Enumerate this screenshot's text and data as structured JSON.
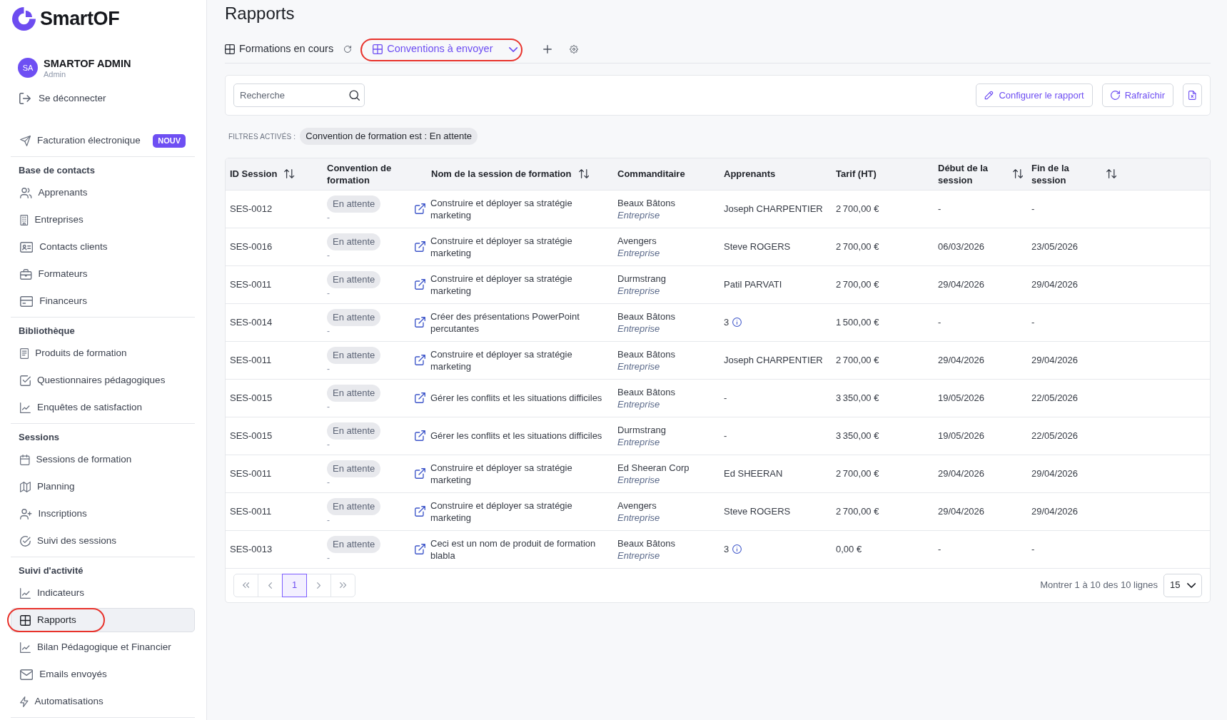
{
  "sidebar": {
    "brand": "SmartOF",
    "user": {
      "initials": "SA",
      "name": "SMARTOF ADMIN",
      "role": "Admin"
    },
    "logout": "Se déconnecter",
    "sections": [
      {
        "items": [
          {
            "label": "Facturation électronique",
            "badge": "NOUV",
            "selected": false,
            "circled": false
          }
        ]
      },
      {
        "heading": "Base de contacts",
        "items": [
          {
            "label": "Apprenants",
            "selected": false,
            "circled": false
          },
          {
            "label": "Entreprises",
            "selected": false,
            "circled": false
          },
          {
            "label": "Contacts clients",
            "selected": false,
            "circled": false
          },
          {
            "label": "Formateurs",
            "selected": false,
            "circled": false
          },
          {
            "label": "Financeurs",
            "selected": false,
            "circled": false
          }
        ]
      },
      {
        "heading": "Bibliothèque",
        "items": [
          {
            "label": "Produits de formation",
            "selected": false,
            "circled": false
          },
          {
            "label": "Questionnaires pédagogiques",
            "selected": false,
            "circled": false
          },
          {
            "label": "Enquêtes de satisfaction",
            "selected": false,
            "circled": false
          }
        ]
      },
      {
        "heading": "Sessions",
        "items": [
          {
            "label": "Sessions de formation",
            "selected": false,
            "circled": false
          },
          {
            "label": "Planning",
            "selected": false,
            "circled": false
          },
          {
            "label": "Inscriptions",
            "selected": false,
            "circled": false
          },
          {
            "label": "Suivi des sessions",
            "selected": false,
            "circled": false
          }
        ]
      },
      {
        "heading": "Suivi d'activité",
        "items": [
          {
            "label": "Indicateurs",
            "selected": false,
            "circled": false
          },
          {
            "label": "Rapports",
            "selected": true,
            "circled": true
          },
          {
            "label": "Bilan Pédagogique et Financier",
            "selected": false,
            "circled": false
          },
          {
            "label": "Emails envoyés",
            "selected": false,
            "circled": false
          },
          {
            "label": "Automatisations",
            "selected": false,
            "circled": false
          }
        ]
      }
    ]
  },
  "page_title": "Rapports",
  "tabs": [
    {
      "label": "Formations en cours",
      "selected": false,
      "circled": false
    },
    {
      "label": "Conventions à envoyer",
      "selected": true,
      "circled": true
    }
  ],
  "toolbar": {
    "search": {
      "placeholder": "Recherche"
    },
    "buttons": [
      "Configurer le rapport",
      "Rafraîchir"
    ]
  },
  "active_filters": {
    "label": "FILTRES ACTIVÉS :",
    "chips": [
      "Convention de formation est : En attente"
    ]
  },
  "table": {
    "columns": [
      {
        "label": "ID Session",
        "sortable": true
      },
      {
        "label": "Convention de formation",
        "sortable": false
      },
      {
        "label": "Nom de la session de formation",
        "sortable": true
      },
      {
        "label": "Commanditaire",
        "sortable": false
      },
      {
        "label": "Apprenants",
        "sortable": false
      },
      {
        "label": "Tarif (HT)",
        "sortable": false
      },
      {
        "label": "Début de la session",
        "sortable": true
      },
      {
        "label": "Fin de la session",
        "sortable": true
      }
    ],
    "rows": [
      {
        "id": "SES-0012",
        "convention": {
          "status": "En attente",
          "note": "-"
        },
        "session": "Construire et déployer sa stratégie marketing",
        "sponsor": {
          "name": "Beaux Bâtons",
          "type": "Entreprise"
        },
        "learners": "Joseph CHARPENTIER",
        "learners_info": false,
        "price": "2 700,00 €",
        "start": "-",
        "end": "-"
      },
      {
        "id": "SES-0016",
        "convention": {
          "status": "En attente",
          "note": "-"
        },
        "session": "Construire et déployer sa stratégie marketing",
        "sponsor": {
          "name": "Avengers",
          "type": "Entreprise"
        },
        "learners": "Steve ROGERS",
        "learners_info": false,
        "price": "2 700,00 €",
        "start": "06/03/2026",
        "end": "23/05/2026"
      },
      {
        "id": "SES-0011",
        "convention": {
          "status": "En attente",
          "note": "-"
        },
        "session": "Construire et déployer sa stratégie marketing",
        "sponsor": {
          "name": "Durmstrang",
          "type": "Entreprise"
        },
        "learners": "Patil PARVATI",
        "learners_info": false,
        "price": "2 700,00 €",
        "start": "29/04/2026",
        "end": "29/04/2026"
      },
      {
        "id": "SES-0014",
        "convention": {
          "status": "En attente",
          "note": "-"
        },
        "session": "Créer des présentations PowerPoint percutantes",
        "sponsor": {
          "name": "Beaux Bâtons",
          "type": "Entreprise"
        },
        "learners": "3",
        "learners_info": true,
        "price": "1 500,00 €",
        "start": "-",
        "end": "-"
      },
      {
        "id": "SES-0011",
        "convention": {
          "status": "En attente",
          "note": "-"
        },
        "session": "Construire et déployer sa stratégie marketing",
        "sponsor": {
          "name": "Beaux Bâtons",
          "type": "Entreprise"
        },
        "learners": "Joseph CHARPENTIER",
        "learners_info": false,
        "price": "2 700,00 €",
        "start": "29/04/2026",
        "end": "29/04/2026"
      },
      {
        "id": "SES-0015",
        "convention": {
          "status": "En attente",
          "note": "-"
        },
        "session": "Gérer les conflits et les situations difficiles",
        "sponsor": {
          "name": "Beaux Bâtons",
          "type": "Entreprise"
        },
        "learners": "-",
        "learners_info": false,
        "price": "3 350,00 €",
        "start": "19/05/2026",
        "end": "22/05/2026"
      },
      {
        "id": "SES-0015",
        "convention": {
          "status": "En attente",
          "note": "-"
        },
        "session": "Gérer les conflits et les situations difficiles",
        "sponsor": {
          "name": "Durmstrang",
          "type": "Entreprise"
        },
        "learners": "-",
        "learners_info": false,
        "price": "3 350,00 €",
        "start": "19/05/2026",
        "end": "22/05/2026"
      },
      {
        "id": "SES-0011",
        "convention": {
          "status": "En attente",
          "note": "-"
        },
        "session": "Construire et déployer sa stratégie marketing",
        "sponsor": {
          "name": "Ed Sheeran Corp",
          "type": "Entreprise"
        },
        "learners": "Ed SHEERAN",
        "learners_info": false,
        "price": "2 700,00 €",
        "start": "29/04/2026",
        "end": "29/04/2026"
      },
      {
        "id": "SES-0011",
        "convention": {
          "status": "En attente",
          "note": "-"
        },
        "session": "Construire et déployer sa stratégie marketing",
        "sponsor": {
          "name": "Avengers",
          "type": "Entreprise"
        },
        "learners": "Steve ROGERS",
        "learners_info": false,
        "price": "2 700,00 €",
        "start": "29/04/2026",
        "end": "29/04/2026"
      },
      {
        "id": "SES-0013",
        "convention": {
          "status": "En attente",
          "note": "-"
        },
        "session": "Ceci est un nom de produit de formation blabla",
        "sponsor": {
          "name": "Beaux Bâtons",
          "type": "Entreprise"
        },
        "learners": "3",
        "learners_info": true,
        "price": "0,00 €",
        "start": "-",
        "end": "-"
      }
    ]
  },
  "pagination": {
    "pages": [
      {
        "label": "1",
        "selected": true
      }
    ],
    "summary": "Montrer 1 à 10 des 10 lignes",
    "page_size": "15"
  }
}
